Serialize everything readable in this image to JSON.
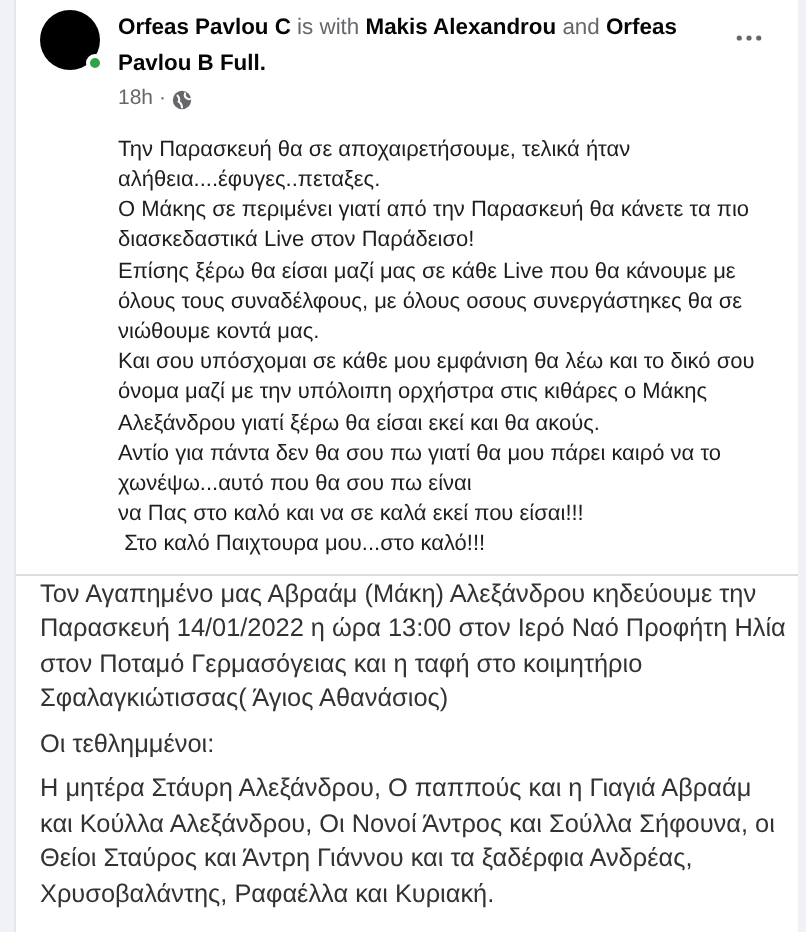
{
  "post": {
    "heading": "**Orfeas Pavlou C** is with **Makis Alexandrou** and **Orfeas Pavlou B Full.**",
    "time": "18h",
    "separator": "·",
    "online": true,
    "paragraphs": [
      "Την Παρασκευή θα σε αποχαιρετήσουμε, τελικά ήταν αλήθεια....έφυγες..πεταξες.",
      "Ο Μάκης σε περιμένει γιατί από την Παρασκευή θα κάνετε τα πιο διασκεδαστικά Live στον Παράδεισο!",
      "Επίσης ξέρω θα είσαι μαζί μας σε κάθε Live που θα κάνουμε με όλους τους συναδέλφους, με όλους οσους συνεργάστηκες θα σε νιώθουμε κοντά μας.",
      "Και σου υπόσχομαι σε κάθε μου εμφάνιση θα λέω και το δικό σου όνομα μαζί με την υπόλοιπη ορχήστρα στις κιθάρες ο Μάκης Αλεξάνδρου γιατί ξέρω θα είσαι εκεί και θα ακούς.",
      "Αντίο για πάντα δεν θα σου πω γιατί θα μου πάρει καιρό να το χωνέψω...αυτό που θα σου πω είναι",
      "να Πας στο καλό και να σε καλά εκεί που είσαι!!!",
      " Στο καλό Παιχτουρα μου...στο καλό!!!"
    ]
  },
  "shared_text": {
    "paragraphs": [
      "Τον Αγαπημένο μας Αβραάμ (Μάκη) Αλεξάνδρου κηδεύουμε την Παρασκευή 14/01/2022 η ώρα 13:00 στον Ιερό Ναό Προφήτη Ηλία στον Ποταμό Γερμασόγειας και η ταφή στο κοιμητήριο Σφαλαγκιώτισσας( Άγιος Αθανάσιος)",
      "Οι τεθλημμένοι:",
      "Η μητέρα Στάυρη Αλεξάνδρου, Ο παππούς και η Γιαγιά Αβραάμ και Κούλλα Αλεξάνδρου, Οι Νονοί Άντρος και Σούλλα Σήφουνα, οι Θείοι Σταύρος και Άντρη Γιάννου και τα ξαδέρφια Ανδρέας, Χρυσοβαλάντης, Ραφαέλλα και Κυριακή."
    ]
  }
}
